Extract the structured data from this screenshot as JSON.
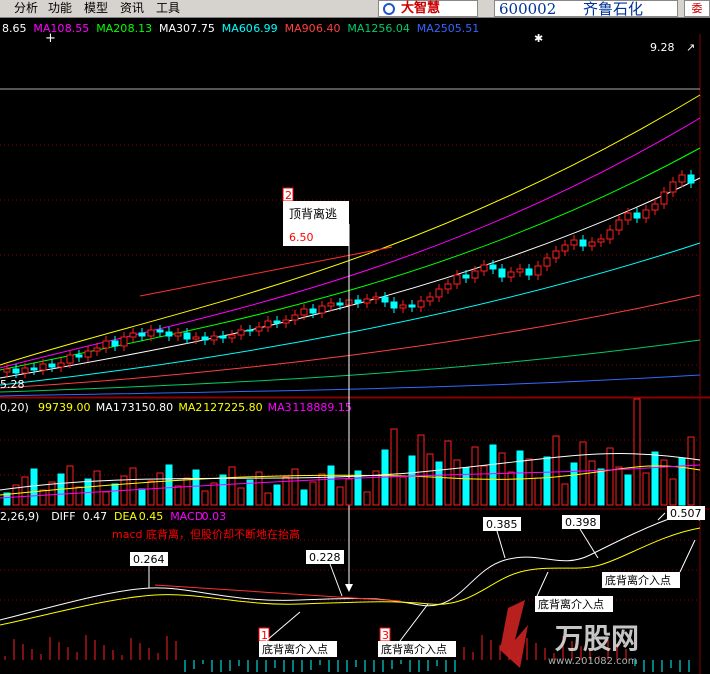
{
  "menu": [
    {
      "label": "分析"
    },
    {
      "label": "功能"
    },
    {
      "label": "模型"
    },
    {
      "label": "资讯"
    },
    {
      "label": "工具"
    }
  ],
  "logo_text": "大智慧",
  "stock": {
    "code": "600002",
    "name": "齐鲁石化"
  },
  "corner_label": "委",
  "price_ma_legend": [
    {
      "text": "8.65",
      "color": "#ffffff"
    },
    {
      "text": "MA10",
      "color": "#ff00ff"
    },
    {
      "text": "8.55",
      "color": "#ff00ff"
    },
    {
      "text": "MA20",
      "color": "#00ff00"
    },
    {
      "text": "8.13",
      "color": "#00ff00"
    },
    {
      "text": "MA30",
      "color": "#ffffff"
    },
    {
      "text": "7.75",
      "color": "#ffffff"
    },
    {
      "text": "MA60",
      "color": "#00ffff"
    },
    {
      "text": "6.99",
      "color": "#00ffff"
    },
    {
      "text": "MA90",
      "color": "#ff4040"
    },
    {
      "text": "6.40",
      "color": "#ff4040"
    },
    {
      "text": "MA125",
      "color": "#00cc66"
    },
    {
      "text": "6.04",
      "color": "#00cc66"
    },
    {
      "text": "MA250",
      "color": "#3366ff"
    },
    {
      "text": "5.51",
      "color": "#3366ff"
    }
  ],
  "volume_legend": [
    {
      "text": "0,20)",
      "color": "#ffffff"
    },
    {
      "text": "99739.00",
      "color": "#ffff00"
    },
    {
      "text": "MA1",
      "color": "#ffffff"
    },
    {
      "text": "73150.80",
      "color": "#ffffff"
    },
    {
      "text": "MA2",
      "color": "#ffff00"
    },
    {
      "text": "127225.80",
      "color": "#ffff00"
    },
    {
      "text": "MA3",
      "color": "#ff00ff"
    },
    {
      "text": "118889.15",
      "color": "#ff00ff"
    }
  ],
  "macd_legend": [
    {
      "text": "2,26,9)",
      "color": "#ffffff"
    },
    {
      "text": "DIFF",
      "color": "#ffffff"
    },
    {
      "text": "0.47",
      "color": "#ffffff"
    },
    {
      "text": "DEA",
      "color": "#ffff00"
    },
    {
      "text": "0.45",
      "color": "#ffff00"
    },
    {
      "text": "MACD",
      "color": "#ff00ff"
    },
    {
      "text": "0.03",
      "color": "#ff00ff"
    }
  ],
  "price_labels": {
    "high": "9.28",
    "low": "5.28"
  },
  "annotations": {
    "top_divergence_num": "2",
    "top_divergence": "顶背离逃",
    "top_price": "6.50",
    "macd_note": "macd 底背离，但股价却不断地在抬高",
    "val_0264": "0.264",
    "val_0228": "0.228",
    "val_0385": "0.385",
    "val_0398": "0.398",
    "val_0507": "0.507",
    "bottom_entry": "底背离介入点",
    "num_1": "1",
    "num_3": "3"
  },
  "watermark": {
    "text": "万股网",
    "url": "www.201082.com"
  },
  "colors": {
    "up": "#ff2020",
    "down": "#00ffff",
    "grid": "#8b0000"
  }
}
